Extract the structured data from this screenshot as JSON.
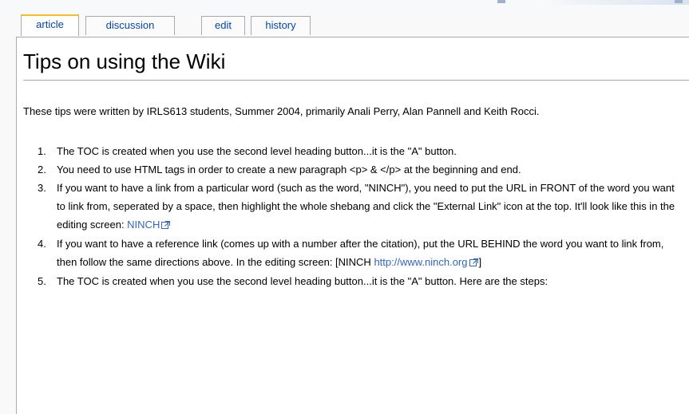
{
  "tabs": {
    "article": "article",
    "discussion": "discussion",
    "edit": "edit",
    "history": "history"
  },
  "page": {
    "title": "Tips on using the Wiki",
    "intro": "These tips were written by IRLS613 students, Summer 2004, primarily Anali Perry, Alan Pannell and Keith Rocci."
  },
  "tips": [
    {
      "number": "1.",
      "text": "The TOC is created when you use the second level heading button...it is the \"A\" button."
    },
    {
      "number": "2.",
      "text": "You need to use HTML tags in order to create a new paragraph <p> & </p> at the beginning and end."
    },
    {
      "number": "3.",
      "text": "If you want to have a link from a particular word (such as the word, \"NINCH\"), you need to put the URL in FRONT of the word you want to link from, seperated by a space, then highlight the whole shebang and click the \"External Link\" icon at the top. It'll look like this in the editing screen: ",
      "link_text": "NINCH"
    },
    {
      "number": "4.",
      "text_before": "If you want to have a reference link (comes up with a number after the citation), put the URL BEHIND the word you want to link from, then follow the same directions above. In the editing screen: [NINCH ",
      "link_text": "http://www.ninch.org",
      "text_after": "]"
    },
    {
      "number": "5.",
      "text": "The TOC is created when you use the second level heading button...it is the \"A\" button. Here are the steps:"
    }
  ],
  "icons": {
    "external_link": "external-link-icon"
  },
  "colors": {
    "link": "#3366bb",
    "tab_link": "#0645ad",
    "selected_tab_accent": "#fabd23"
  }
}
